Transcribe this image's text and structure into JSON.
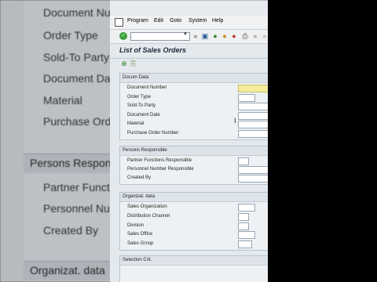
{
  "background": {
    "labels": [
      "Document Nu",
      "Order Type",
      "Sold-To Party",
      "Document Da",
      "Material",
      "Purchase Ord"
    ],
    "group_labels": [
      "Persons Respon",
      "Organizat. data"
    ],
    "person_labels": [
      "Partner Functio",
      "Personnel Nu",
      "Created By"
    ]
  },
  "menubar": {
    "items": [
      "Program",
      "Edit",
      "Goto",
      "System",
      "Help"
    ]
  },
  "window": {
    "title": "List of Sales Orders"
  },
  "groups": {
    "docum": {
      "title": "Docum Data",
      "fields": [
        "Document Number",
        "Order Type",
        "Sold-To Party",
        "Document Date",
        "Material",
        "Purchase Order Number"
      ]
    },
    "persons": {
      "title": "Persons Responsible",
      "fields": [
        "Partner Functions Responsible",
        "Personnel Number Responsible",
        "Created By"
      ]
    },
    "organizat": {
      "title": "Organizat. data",
      "fields": [
        "Sales Organization",
        "Distribution Channel",
        "Division",
        "Sales Office",
        "Sales Group"
      ]
    },
    "selection": {
      "title": "Selection Crit."
    }
  },
  "icons": {
    "ok": "check-icon",
    "toolbar": [
      "save-icon",
      "back-icon",
      "exit-icon",
      "cancel-icon",
      "print-icon",
      "find-icon"
    ],
    "app": [
      "execute-icon",
      "variant-icon"
    ]
  },
  "colors": {
    "required_field": "#f4ec9a",
    "ok_green": "#3aa03a"
  }
}
